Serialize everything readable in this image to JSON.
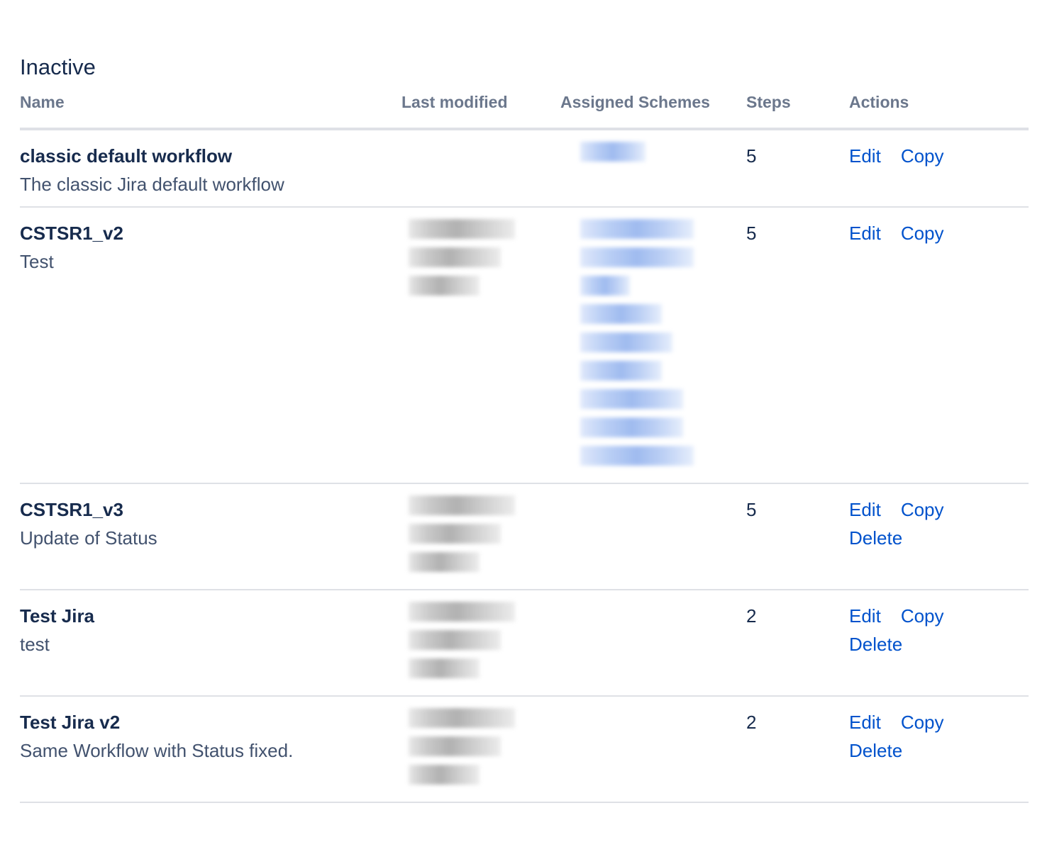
{
  "section": {
    "title": "Inactive"
  },
  "columns": {
    "name": "Name",
    "last_modified": "Last modified",
    "assigned_schemes": "Assigned Schemes",
    "steps": "Steps",
    "actions": "Actions"
  },
  "actions": {
    "edit": "Edit",
    "copy": "Copy",
    "delete": "Delete"
  },
  "rows": [
    {
      "name": "classic default workflow",
      "description": "The classic Jira default workflow",
      "steps": "5"
    },
    {
      "name": "CSTSR1_v2",
      "description": "Test",
      "steps": "5"
    },
    {
      "name": "CSTSR1_v3",
      "description": "Update of Status",
      "steps": "5"
    },
    {
      "name": "Test Jira",
      "description": "test",
      "steps": "2"
    },
    {
      "name": "Test Jira v2",
      "description": "Same Workflow with Status fixed.",
      "steps": "2"
    }
  ]
}
